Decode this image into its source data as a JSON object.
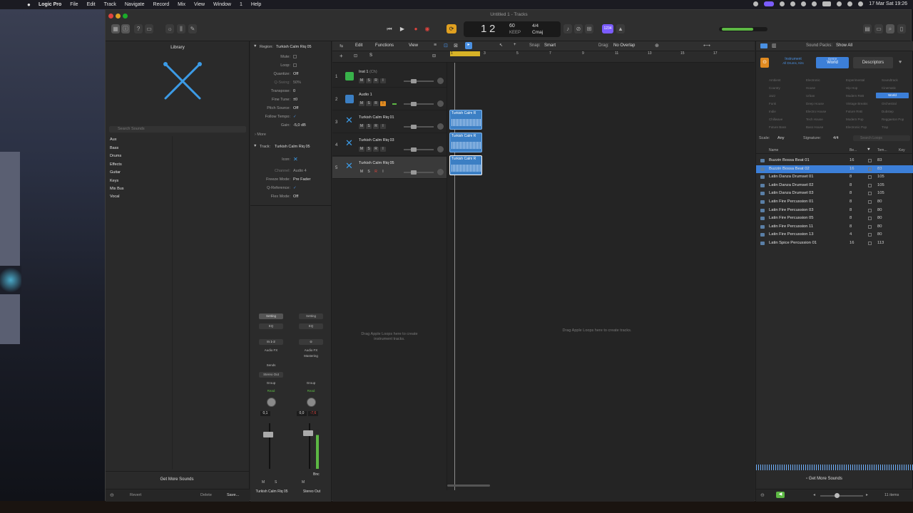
{
  "menubar": {
    "app": "Logic Pro",
    "items": [
      "File",
      "Edit",
      "Track",
      "Navigate",
      "Record",
      "Mix",
      "View",
      "Window",
      "1",
      "Help"
    ],
    "clock": "17 Mar Sat 19:26"
  },
  "window": {
    "title": "Untitled 1 - Tracks"
  },
  "lcd": {
    "bar": "1",
    "beat": "2",
    "tempo": "60",
    "tempo_label": "KEEP",
    "sig": "4/4",
    "key": "Cmaj",
    "count_in": "1234"
  },
  "library": {
    "title": "Library",
    "search_placeholder": "Search Sounds",
    "categories": [
      "Aux",
      "Bass",
      "Drums",
      "Effects",
      "Guitar",
      "Keys",
      "Mix Bus",
      "Vocal"
    ],
    "get_more": "Get More Sounds",
    "revert": "Revert",
    "delete": "Delete",
    "save": "Save..."
  },
  "inspector": {
    "region_label": "Region:",
    "region_name": "Turkish Calm Riq 05",
    "rows": [
      {
        "k": "Mute:",
        "v": ""
      },
      {
        "k": "Loop:",
        "v": ""
      },
      {
        "k": "Quantize:",
        "v": "Off"
      },
      {
        "k": "Q-Swing:",
        "v": "50%"
      },
      {
        "k": "Transpose:",
        "v": "0"
      },
      {
        "k": "Fine Tune:",
        "v": "±0"
      },
      {
        "k": "Pitch Source:",
        "v": "Off"
      },
      {
        "k": "Follow Tempo:",
        "v": "✓"
      },
      {
        "k": "Gain:",
        "v": "-5,0 dB"
      }
    ],
    "more": "More",
    "track_label": "Track:",
    "track_name": "Turkish Calm Riq 05",
    "track_rows": [
      {
        "k": "Icon:",
        "v": ""
      },
      {
        "k": "Channel:",
        "v": "Audio 4"
      },
      {
        "k": "Freeze Mode:",
        "v": "Pre Fader"
      },
      {
        "k": "Q-Reference:",
        "v": "✓"
      },
      {
        "k": "Flex Mode:",
        "v": "Off"
      }
    ],
    "strip1": {
      "setting": "Setting",
      "eq": "EQ",
      "input": "In 1-2",
      "audiofx": "Audio FX",
      "sends": "Sends",
      "output": "Stereo Out",
      "group": "Group",
      "read": "Read",
      "pan": "0,1",
      "name": "Turkish Calm Riq 05"
    },
    "strip2": {
      "setting": "Setting",
      "eq": "EQ",
      "audiofx": "Audio FX",
      "mastering": "Mastering",
      "group": "Group",
      "read": "Read",
      "pan": "0,0",
      "vol": "-7,6",
      "bnc": "Bnc",
      "name": "Stereo Out"
    }
  },
  "tracks_toolbar": {
    "edit": "Edit",
    "functions": "Functions",
    "view": "View",
    "snap_label": "Snap:",
    "snap_value": "Smart",
    "drag_label": "Drag:",
    "drag_value": "No Overlap"
  },
  "ruler": [
    "1",
    "3",
    "5",
    "7",
    "9",
    "11",
    "13",
    "15",
    "17"
  ],
  "tracks": [
    {
      "num": "1",
      "name": "Inst 1",
      "sub": "(Ch)",
      "color": "#38b24a"
    },
    {
      "num": "2",
      "name": "Audio 1",
      "sub": "",
      "color": "#3b7fc4"
    },
    {
      "num": "3",
      "name": "Turkish Calm Riq 01",
      "sub": "",
      "color": "#3b7fc4"
    },
    {
      "num": "4",
      "name": "Turkish Calm Riq 03",
      "sub": "",
      "color": "#3b7fc4"
    },
    {
      "num": "5",
      "name": "Turkish Calm Riq 05",
      "sub": "",
      "color": "#3b7fc4"
    }
  ],
  "regions": [
    "Turkish Calm R",
    "Turkish Calm R",
    "Turkish Calm R"
  ],
  "hints": {
    "instrument": "Drag Apple Loops here to create instrument tracks.",
    "main": "Drag Apple Loops here to create tracks."
  },
  "browser": {
    "sound_packs_label": "Sound Packs:",
    "sound_packs_value": "Show All",
    "tabs": [
      {
        "label": "Instrument",
        "sub": "All Drums, Kits"
      },
      {
        "label": "Genre",
        "sub": "World"
      },
      {
        "label": "Descriptors",
        "sub": ""
      }
    ],
    "genres": [
      "Ambient",
      "Electronic",
      "Experimental",
      "Soundtrack",
      "Country",
      "House",
      "Hip Hop",
      "Cinematic",
      "Jazz",
      "Urban",
      "Modern RnB",
      "World",
      "Funk",
      "Deep House",
      "Vintage Breaks",
      "Orchestral",
      "Indie",
      "Electro House",
      "Future RnB",
      "Dubstep",
      "Chillwave",
      "Tech House",
      "Modern Pop",
      "Reggaeton Pop",
      "Future Bass",
      "Bass House",
      "Electronic Pop",
      "Trap"
    ],
    "scale_label": "Scale:",
    "scale_value": "Any",
    "sig_label": "Signature:",
    "sig_value": "4/4",
    "search_placeholder": "Search Loops",
    "col_name": "Name",
    "col_beats": "Be...",
    "col_tempo": "Tem...",
    "col_key": "Key",
    "loops": [
      {
        "name": "Buzzin Bossa Beat 01",
        "beats": "16",
        "tempo": "83"
      },
      {
        "name": "Buzzin Bossa Beat 02",
        "beats": "16",
        "tempo": "83"
      },
      {
        "name": "Latin Danza Drumset 01",
        "beats": "8",
        "tempo": "105"
      },
      {
        "name": "Latin Danza Drumset 02",
        "beats": "8",
        "tempo": "105"
      },
      {
        "name": "Latin Danza Drumset 03",
        "beats": "8",
        "tempo": "105"
      },
      {
        "name": "Latin Fire Percussion 01",
        "beats": "8",
        "tempo": "80"
      },
      {
        "name": "Latin Fire Percussion 03",
        "beats": "8",
        "tempo": "80"
      },
      {
        "name": "Latin Fire Percussion 05",
        "beats": "8",
        "tempo": "80"
      },
      {
        "name": "Latin Fire Percussion 11",
        "beats": "8",
        "tempo": "80"
      },
      {
        "name": "Latin Fire Percussion 13",
        "beats": "4",
        "tempo": "80"
      },
      {
        "name": "Latin Spice Percussion 01",
        "beats": "16",
        "tempo": "113"
      }
    ],
    "selected_index": 1,
    "get_more": "Get More Sounds",
    "item_count": "11 items"
  }
}
